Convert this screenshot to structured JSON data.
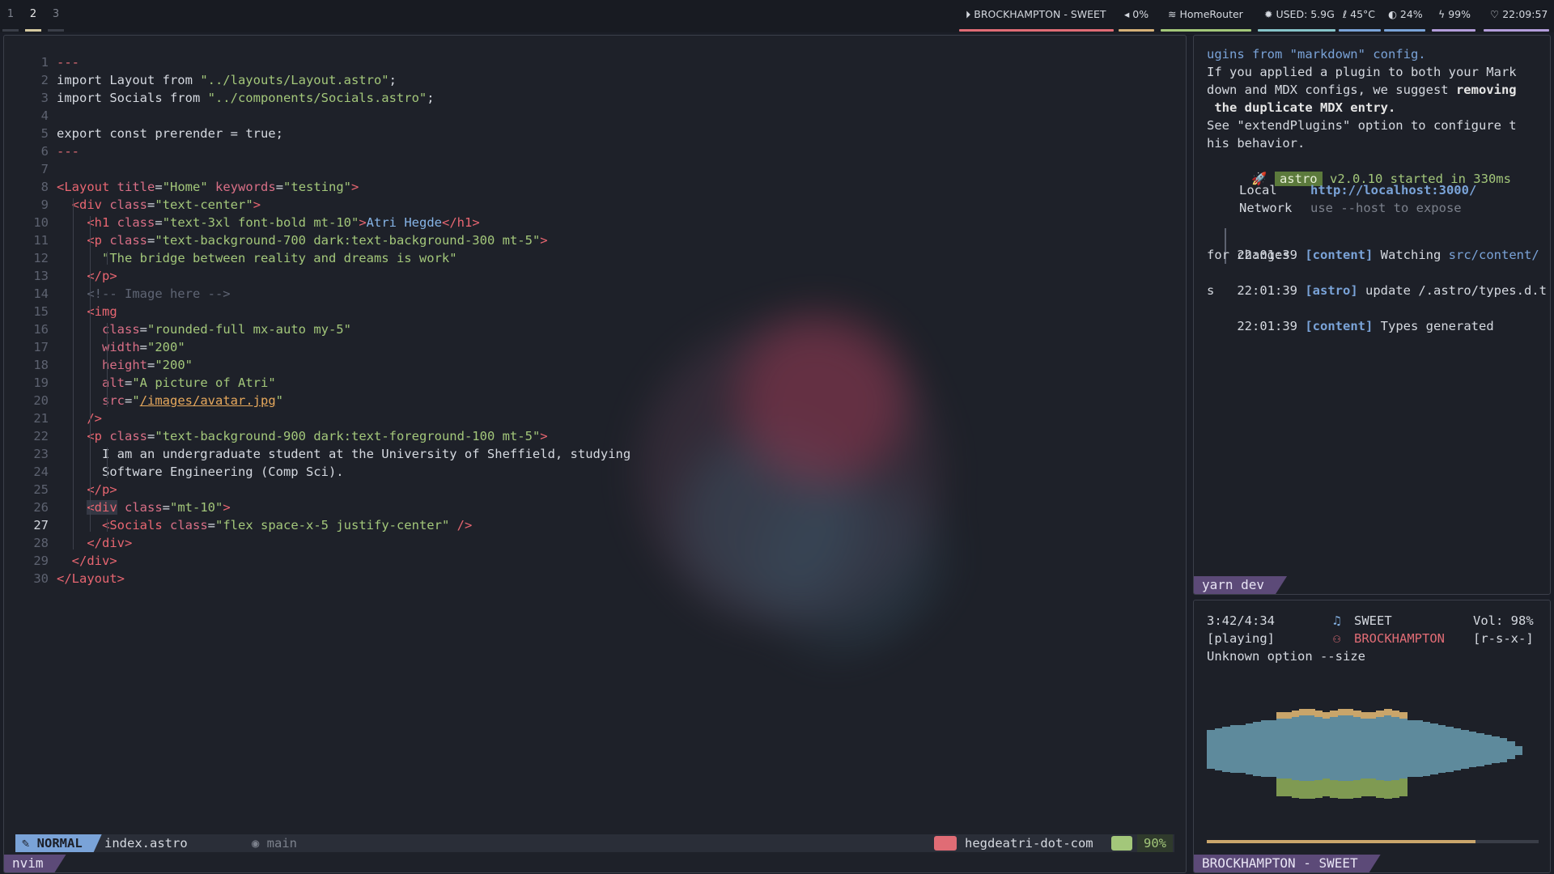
{
  "topbar": {
    "workspaces": [
      "1",
      "2",
      "3"
    ],
    "active_workspace": "2",
    "now_playing": "BROCKHAMPTON - SWEET",
    "volume": "0%",
    "network": "HomeRouter",
    "memory": "USED: 5.9G",
    "temperature": "45°C",
    "brightness": "24%",
    "battery": "99%",
    "clock": "22:09:57",
    "colors": {
      "now_playing": "#e06c75",
      "volume": "#d5b078",
      "network": "#a3c77a",
      "memory": "#86c4c9",
      "temperature": "#7aa3d8",
      "brightness": "#7aa3d8",
      "battery": "#b39ddb",
      "clock": "#b39ddb"
    }
  },
  "editor": {
    "current_line": 27,
    "lines": [
      "---",
      "import Layout from \"../layouts/Layout.astro\";",
      "import Socials from \"../components/Socials.astro\";",
      "",
      "export const prerender = true;",
      "---",
      "",
      "<Layout title=\"Home\" keywords=\"testing\">",
      "  <div class=\"text-center\">",
      "    <h1 class=\"text-3xl font-bold mt-10\">Atri Hegde</h1>",
      "    <p class=\"text-background-700 dark:text-background-300 mt-5\">",
      "      \"The bridge between reality and dreams is work\"",
      "    </p>",
      "    <!-- Image here -->",
      "    <img",
      "      class=\"rounded-full mx-auto my-5\"",
      "      width=\"200\"",
      "      height=\"200\"",
      "      alt=\"A picture of Atri\"",
      "      src=\"/images/avatar.jpg\"",
      "    />",
      "    <p class=\"text-background-900 dark:text-foreground-100 mt-5\">",
      "      I am an undergraduate student at the University of Sheffield, studying",
      "      Software Engineering (Comp Sci).",
      "    </p>",
      "    <div class=\"mt-10\">",
      "      <Socials class=\"flex space-x-5 justify-center\" />",
      "    </div>",
      "  </div>",
      "</Layout>"
    ],
    "statusline": {
      "mode": "NORMAL",
      "file": "index.astro",
      "branch": "main",
      "project": "hegdeatri-dot-com",
      "percent": "90%"
    },
    "pane_label": "nvim"
  },
  "dev": {
    "pane_label": "yarn dev",
    "lines": [
      "ugins from \"markdown\" config.",
      "If you applied a plugin to both your Mark",
      "down and MDX configs, we suggest removing",
      " the duplicate MDX entry.",
      "See \"extendPlugins\" option to configure t",
      "his behavior."
    ],
    "astro_badge": "astro",
    "astro_version": "v2.0.10 started in 330ms",
    "local_label": "Local",
    "local_url": "http://localhost:3000/",
    "network_label": "Network",
    "network_value": "use --host to expose",
    "log": [
      {
        "time": "22:01:39",
        "tag": "[content]",
        "msg": "Watching",
        "path": "src/content/",
        "cont": "for changes"
      },
      {
        "time": "22:01:39",
        "tag": "[astro]",
        "msg": "update /.astro/types.d.t",
        "cont": "s"
      },
      {
        "time": "22:01:39",
        "tag": "[content]",
        "msg": "Types generated"
      }
    ]
  },
  "music": {
    "pane_label": "BROCKHAMPTON - SWEET",
    "elapsed": "3:42/4:34",
    "track": "SWEET",
    "artist": "BROCKHAMPTON",
    "volume": "Vol: 98%",
    "state": "[playing]",
    "flags": "[r-s-x-]",
    "error": "Unknown option --size",
    "progress": 0.81,
    "visualizer_heights": [
      26,
      28,
      30,
      32,
      32,
      34,
      36,
      38,
      38,
      40,
      40,
      42,
      44,
      44,
      42,
      40,
      42,
      44,
      44,
      42,
      40,
      40,
      42,
      44,
      42,
      40,
      38,
      38,
      36,
      34,
      32,
      30,
      28,
      26,
      24,
      22,
      20,
      18,
      16,
      12,
      6
    ]
  }
}
